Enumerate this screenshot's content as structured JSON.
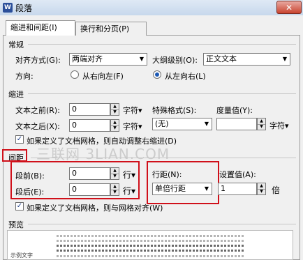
{
  "window": {
    "title": "段落",
    "app_icon": "W",
    "close_label": "✕"
  },
  "tabs": [
    {
      "label": "缩进和间距(I)",
      "active": true
    },
    {
      "label": "换行和分页(P)",
      "active": false
    }
  ],
  "general": {
    "section_title": "常规",
    "alignment_label": "对齐方式(G):",
    "alignment_value": "两端对齐",
    "outline_label": "大纲级别(O):",
    "outline_value": "正文文本",
    "direction_label": "方向:",
    "direction_rtl_label": "从右向左(F)",
    "direction_ltr_label": "从左向右(L)",
    "direction_selected": "ltr"
  },
  "indent": {
    "section_title": "缩进",
    "before_label": "文本之前(R):",
    "before_value": "0",
    "before_unit": "字符▾",
    "after_label": "文本之后(X):",
    "after_value": "0",
    "after_unit": "字符▾",
    "special_label": "特殊格式(S):",
    "special_value": "(无)",
    "measure_label": "度量值(Y):",
    "measure_value": "",
    "measure_unit": "字符▾",
    "grid_check_label": "如果定义了文档网格，则自动调整右缩进(D)",
    "grid_checked": true
  },
  "spacing": {
    "section_title": "间距",
    "before_label": "段前(B):",
    "before_value": "0",
    "before_unit": "行▾",
    "after_label": "段后(E):",
    "after_value": "0",
    "after_unit": "行▾",
    "line_spacing_label": "行距(N):",
    "line_spacing_value": "单倍行距",
    "setting_label": "设置值(A):",
    "setting_value": "1",
    "setting_unit": "倍",
    "grid_check_label": "如果定义了文档网格，则与网格对齐(W)",
    "grid_checked": true
  },
  "preview": {
    "section_title": "预览",
    "sample_label": "示例文字"
  },
  "watermark": "三联网 3LIAN.COM",
  "colors": {
    "highlight_box": "#d0101a",
    "title_bar": "#c7d8ec",
    "dialog_background": "#f0f0f0"
  }
}
